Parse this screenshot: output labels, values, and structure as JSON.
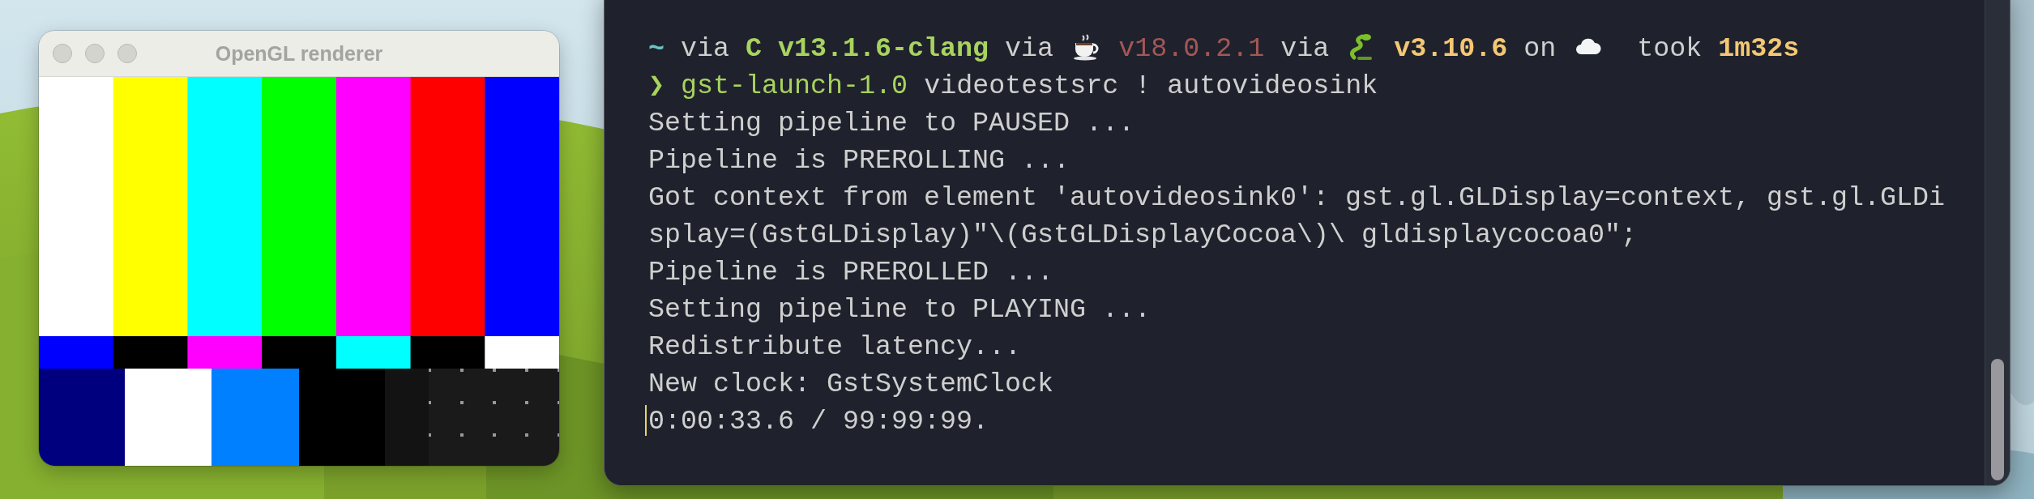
{
  "video_window": {
    "title": "OpenGL renderer",
    "kind": "picture"
  },
  "terminal": {
    "prompt": {
      "path": "~",
      "modules": [
        {
          "kind": "c",
          "prefix": "via",
          "version": "C v13.1.6-clang"
        },
        {
          "kind": "java",
          "prefix": "via",
          "version": "v18.0.2.1"
        },
        {
          "kind": "python",
          "prefix": "via",
          "version": "v3.10.6"
        },
        {
          "kind": "cloud",
          "prefix": "on"
        }
      ],
      "duration_label": "took",
      "duration": "1m32s"
    },
    "command": {
      "symbol": "❯",
      "program": "gst-launch-1.0",
      "arguments": "videotestsrc ! autovideosink"
    },
    "output": [
      "Setting pipeline to PAUSED ...",
      "Pipeline is PREROLLING ...",
      "Got context from element 'autovideosink0': gst.gl.GLDisplay=context, gst.gl.GLDisplay=(GstGLDisplay)\"\\(GstGLDisplayCocoa\\)\\ gldisplaycocoa0\";",
      "Pipeline is PREROLLED ...",
      "Setting pipeline to PLAYING ...",
      "Redistribute latency...",
      "New clock: GstSystemClock",
      "0:00:33.6 / 99:99:99."
    ]
  }
}
